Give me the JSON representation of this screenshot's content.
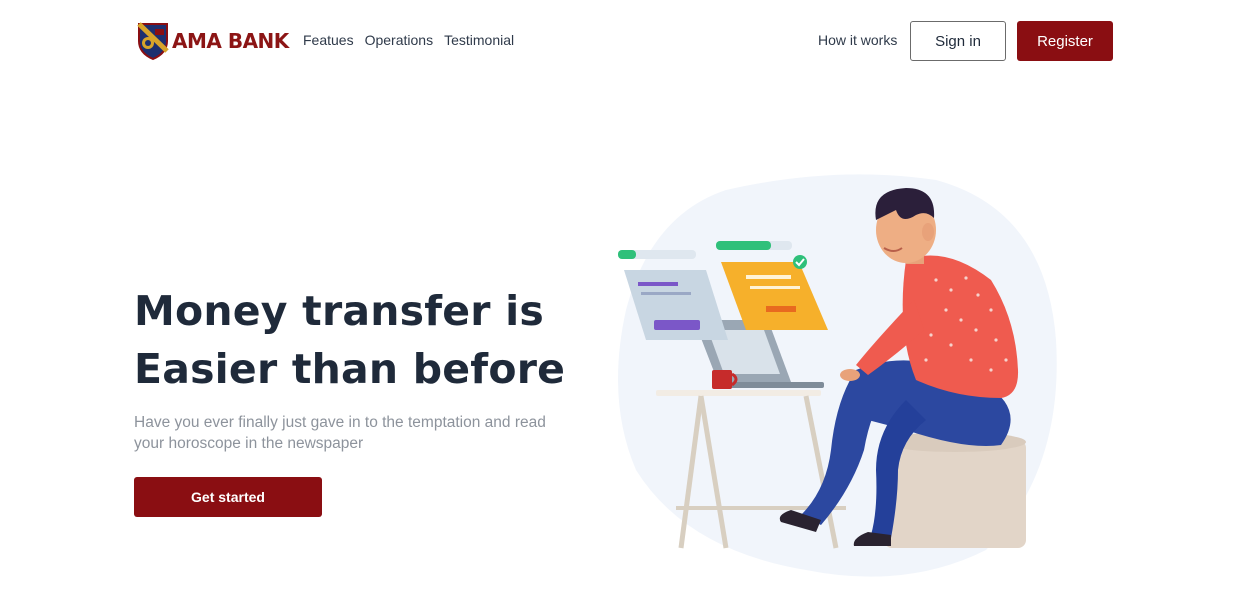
{
  "brand": {
    "name": "AMA BANK",
    "colors": {
      "primary": "#8a0e12",
      "text": "#1f2a3a",
      "muted": "#8d939c"
    },
    "logo_icon": "shield-crest-icon"
  },
  "nav": {
    "links": [
      "Featues",
      "Operations",
      "Testimonial"
    ],
    "how_it_works": "How it works",
    "sign_in": "Sign in",
    "register": "Register"
  },
  "hero": {
    "title_line1": "Money transfer is",
    "title_line2": "Easier than before",
    "subtitle": "Have you ever finally just gave in to the temptation and read your horoscope in the newspaper",
    "cta": "Get started",
    "illustration_icon": "person-laptop-illustration"
  }
}
